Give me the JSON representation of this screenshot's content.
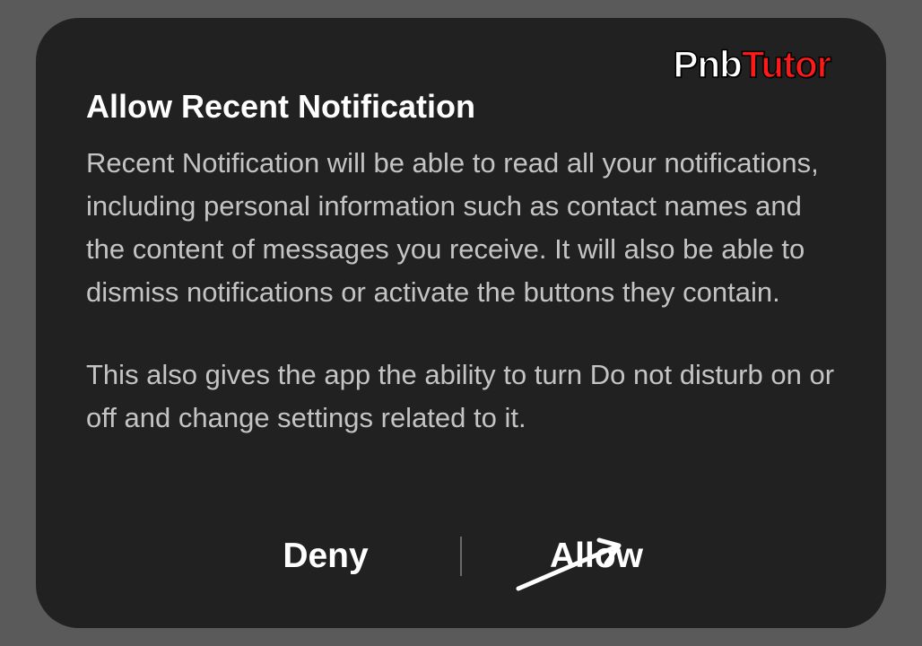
{
  "dialog": {
    "title": "Allow Recent Notification",
    "paragraph1": "Recent Notification will be able to read all your notifications, including personal information such as contact names and the content of messages you receive. It will also be able to dismiss notifications or activate the buttons they contain.",
    "paragraph2": "This also gives the app the ability to turn Do not disturb on or off and change settings related to it.",
    "deny_label": "Deny",
    "allow_label": "Allow"
  },
  "logo": {
    "part1": "Pnb",
    "part2": "Tutor"
  }
}
